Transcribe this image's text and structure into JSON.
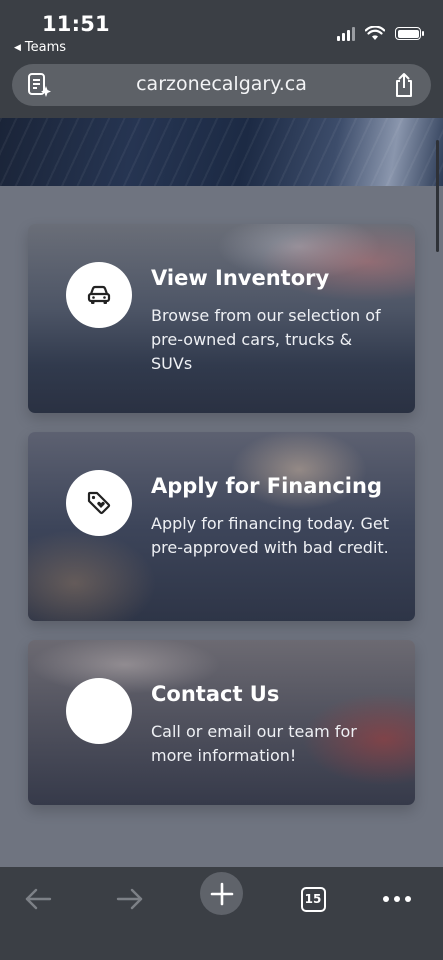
{
  "status_bar": {
    "time": "11:51",
    "back_app": "Teams"
  },
  "browser": {
    "url": "carzonecalgary.ca",
    "tab_count": "15"
  },
  "cards": [
    {
      "title": "View Inventory",
      "description": "Browse from our selection of pre-owned cars, trucks & SUVs",
      "icon": "car-icon"
    },
    {
      "title": "Apply for Financing",
      "description": "Apply for financing today. Get pre-approved with bad credit.",
      "icon": "price-tag-icon"
    },
    {
      "title": "Contact Us",
      "description": "Call or email our team for more information!",
      "icon": "contact-icon"
    }
  ],
  "colors": {
    "chrome": "#3b3f45",
    "page_background": "#6f7480",
    "icon_circle": "#ffffff"
  }
}
